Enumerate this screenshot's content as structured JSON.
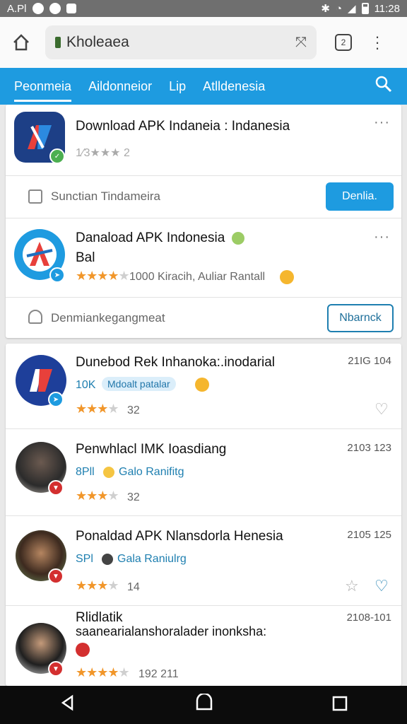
{
  "statusbar": {
    "left_text": "A.Pl",
    "time": "11:28"
  },
  "browser": {
    "url": "Kholeaea",
    "tab_count": "2"
  },
  "nav": {
    "tabs": [
      {
        "label": "Peonmeia"
      },
      {
        "label": "Aildonneior"
      },
      {
        "label": "Lip"
      },
      {
        "label": "Atlldenesia"
      }
    ]
  },
  "featured": [
    {
      "title": "Download APK Indaneia : Indanesia",
      "meta": "1⁄3★★★ 2",
      "footer_text": "Sunctian Tindameira",
      "button": "Denlia."
    },
    {
      "title": "Danaload APK Indonesia",
      "subtitle": "Bal",
      "meta": "1000 Kiracih, Auliar Rantall",
      "footer_text": "Denmiankegangmeat",
      "button": "Nbarnck"
    }
  ],
  "list": [
    {
      "title": "Dunebod Rek Inhanoka:.inodarial",
      "date": "21IG 104",
      "sub": "10K",
      "pill": "Mdoalt patalar",
      "rating_count": "32"
    },
    {
      "title": "Penwhlacl IMK Ioasdiang",
      "date": "2103 123",
      "sub": "8Pll",
      "sub2": "Galo Ranifitg",
      "rating_count": "32"
    },
    {
      "title": "Ponaldad APK Nlansdorla Henesia",
      "date": "2105 125",
      "sub": "SPl",
      "sub2": "Gala Raniulrg",
      "rating_count": "14"
    },
    {
      "title": "Rlidlatik",
      "title2": "saanearialanshoralader inonksha:",
      "date": "2108-101",
      "rating_count": "192 211"
    }
  ],
  "colors": {
    "accent": "#1e9be0",
    "star": "#f1962a"
  }
}
